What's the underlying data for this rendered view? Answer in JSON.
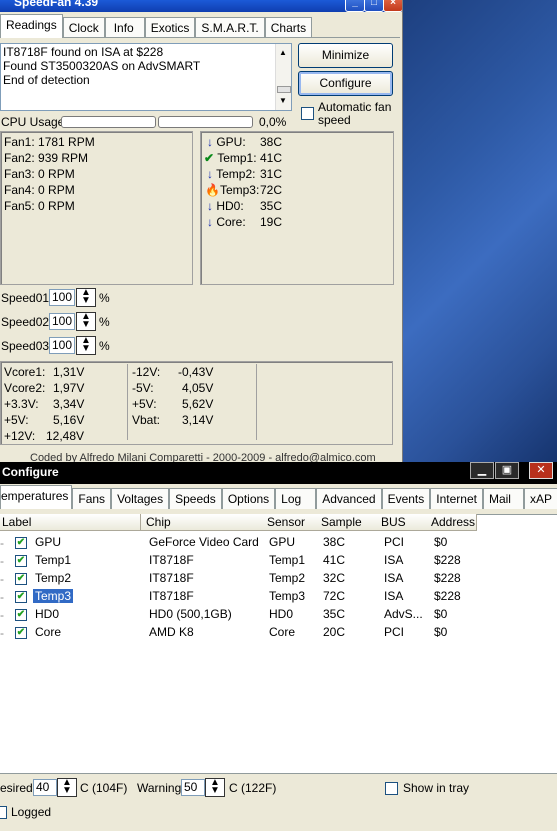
{
  "speedfan": {
    "title": "SpeedFan 4.39",
    "tabs": [
      "Readings",
      "Clock",
      "Info",
      "Exotics",
      "S.M.A.R.T.",
      "Charts"
    ],
    "log_lines": [
      "IT8718F found on ISA at $228",
      "Found ST3500320AS on AdvSMART",
      "End of detection"
    ],
    "minimize_label": "Minimize",
    "configure_label": "Configure",
    "auto_fan_label": "Automatic fan speed",
    "cpu_usage_label": "CPU Usage",
    "cpu_usage_value": "0,0%",
    "fans": [
      "Fan1: 1781 RPM",
      "Fan2: 939 RPM",
      "Fan3: 0 RPM",
      "Fan4: 0 RPM",
      "Fan5: 0 RPM"
    ],
    "temps": [
      {
        "icon": "arrow-down-icon",
        "label": "GPU:",
        "value": "38C"
      },
      {
        "icon": "checkmark-icon",
        "label": "Temp1:",
        "value": "41C"
      },
      {
        "icon": "arrow-down-icon",
        "label": "Temp2:",
        "value": "31C"
      },
      {
        "icon": "flame-icon",
        "label": "Temp3:",
        "value": "72C"
      },
      {
        "icon": "arrow-down-icon",
        "label": "HD0:",
        "value": "35C"
      },
      {
        "icon": "arrow-down-icon",
        "label": "Core:",
        "value": "19C"
      }
    ],
    "speeds": [
      {
        "label": "Speed01:",
        "value": "100",
        "unit": "%"
      },
      {
        "label": "Speed02:",
        "value": "100",
        "unit": "%"
      },
      {
        "label": "Speed03:",
        "value": "100",
        "unit": "%"
      }
    ],
    "volts_left": [
      {
        "label": "Vcore1:",
        "value": "1,31V"
      },
      {
        "label": "Vcore2:",
        "value": "1,97V"
      },
      {
        "label": "+3.3V:",
        "value": "3,34V"
      },
      {
        "label": "+5V:",
        "value": "5,16V"
      },
      {
        "label": "+12V:",
        "value": "12,48V"
      }
    ],
    "volts_right": [
      {
        "label": "-12V:",
        "value": "-0,43V"
      },
      {
        "label": "-5V:",
        "value": "4,05V"
      },
      {
        "label": "+5V:",
        "value": "5,62V"
      },
      {
        "label": "Vbat:",
        "value": "3,14V"
      }
    ],
    "footer": "Coded by Alfredo Milani Comparetti - 2000-2009 - alfredo@almico.com"
  },
  "configure": {
    "title": "Configure",
    "tabs": [
      "emperatures",
      "Fans",
      "Voltages",
      "Speeds",
      "Options",
      "Log",
      "Advanced",
      "Events",
      "Internet",
      "Mail",
      "xAP"
    ],
    "columns": [
      "Label",
      "Chip",
      "Sensor",
      "Sample",
      "BUS",
      "Address"
    ],
    "rows": [
      {
        "label": "GPU",
        "chip": "GeForce Video Card",
        "sensor": "GPU",
        "sample": "38C",
        "bus": "PCI",
        "address": "$0"
      },
      {
        "label": "Temp1",
        "chip": "IT8718F",
        "sensor": "Temp1",
        "sample": "41C",
        "bus": "ISA",
        "address": "$228"
      },
      {
        "label": "Temp2",
        "chip": "IT8718F",
        "sensor": "Temp2",
        "sample": "32C",
        "bus": "ISA",
        "address": "$228"
      },
      {
        "label": "Temp3",
        "chip": "IT8718F",
        "sensor": "Temp3",
        "sample": "72C",
        "bus": "ISA",
        "address": "$228"
      },
      {
        "label": "HD0",
        "chip": "HD0 (500,1GB)",
        "sensor": "HD0",
        "sample": "35C",
        "bus": "AdvS...",
        "address": "$0"
      },
      {
        "label": "Core",
        "chip": "AMD K8",
        "sensor": "Core",
        "sample": "20C",
        "bus": "PCI",
        "address": "$0"
      }
    ],
    "selected_row": "Temp3",
    "desired_label": "esired",
    "desired_value": "40",
    "desired_unit": "C (104F)",
    "warning_label": "Warning",
    "warning_value": "50",
    "warning_unit": "C (122F)",
    "show_in_tray_label": "Show in tray",
    "logged_label": "Logged"
  }
}
